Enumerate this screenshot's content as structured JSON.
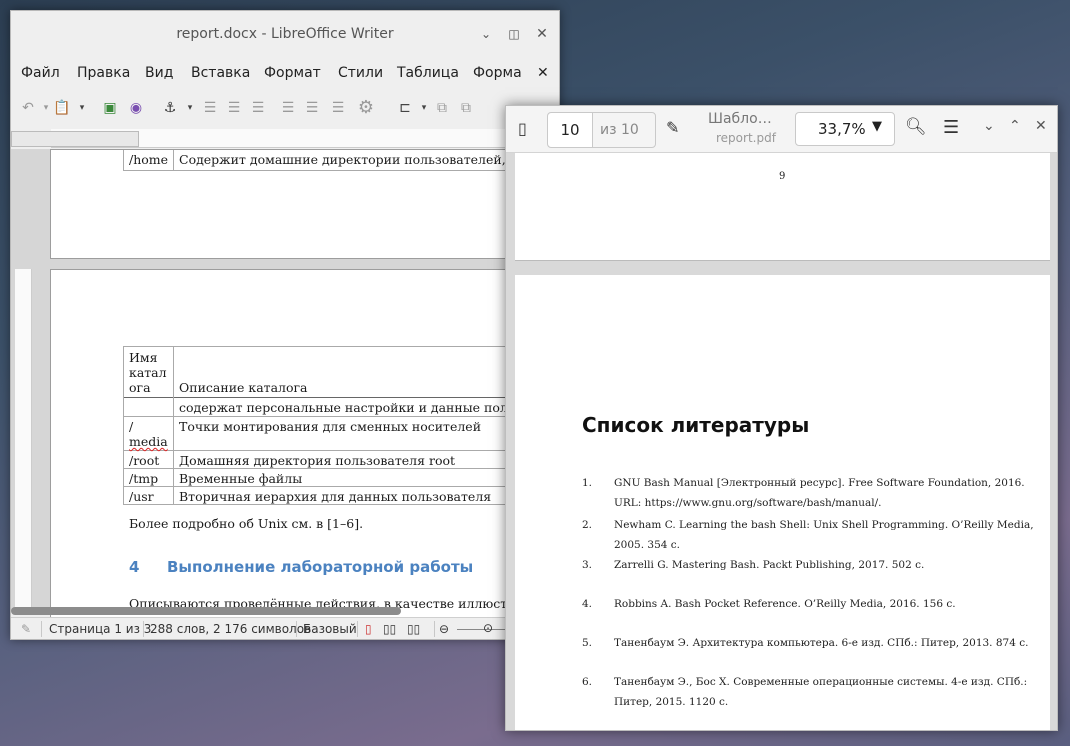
{
  "writer": {
    "title": "report.docx - LibreOffice Writer",
    "menu": [
      "Файл",
      "Правка",
      "Вид",
      "Вставка",
      "Формат",
      "Стили",
      "Таблица",
      "Форма"
    ],
    "page1_row": {
      "dir": "/home",
      "desc": "Содержит домашние директории пользователей, котор"
    },
    "table": {
      "header": {
        "name": [
          "Имя",
          "катал",
          "ога"
        ],
        "desc": "Описание каталога"
      },
      "rows": [
        {
          "dir": "",
          "desc": "содержат персональные настройки и данные пользоват"
        },
        {
          "dir": [
            "/",
            "media"
          ],
          "desc": "Точки монтирования для сменных носителей"
        },
        {
          "dir": "/root",
          "desc": "Домашняя директория пользователя root"
        },
        {
          "dir": "/tmp",
          "desc": "Временные файлы"
        },
        {
          "dir": "/usr",
          "desc": "Вторичная иерархия для данных пользователя"
        }
      ]
    },
    "after_table": "Более подробно об Unix см. в [1–6].",
    "section_num": "4",
    "section_title": "Выполнение лабораторной работы",
    "body_text": "Описываются проведённые действия, в качестве иллюстрации д",
    "status": {
      "page": "Страница 1 из 3",
      "words": "288 слов, 2 176 символов",
      "style": "Базовый"
    }
  },
  "pdf": {
    "page_current": "10",
    "page_total": "из 10",
    "doc_title": "Шабло…",
    "doc_file": "report.pdf",
    "zoom": "33,7%",
    "prev_page_number": "9",
    "heading": "Список литературы",
    "refs": [
      {
        "n": "1.",
        "lines": [
          "GNU Bash Manual [Электронный ресурс]. Free Software Foundation, 2016.",
          "URL: https://www.gnu.org/software/bash/manual/."
        ]
      },
      {
        "n": "2.",
        "lines": [
          "Newham C. Learning the bash Shell: Unix Shell Programming. O’Reilly Media,",
          "2005. 354 с."
        ]
      },
      {
        "n": "3.",
        "lines": [
          "Zarrelli G. Mastering Bash. Packt Publishing, 2017. 502 с."
        ]
      },
      {
        "n": "4.",
        "lines": [
          "Robbins A. Bash Pocket Reference. O’Reilly Media, 2016. 156 с."
        ]
      },
      {
        "n": "5.",
        "lines": [
          "Таненбаум Э. Архитектура компьютера. 6-е изд. СПб.: Питер, 2013. 874 с."
        ]
      },
      {
        "n": "6.",
        "lines": [
          "Таненбаум Э., Бос Х. Современные операционные системы. 4-е изд. СПб.:",
          "Питер, 2015. 1120 с."
        ]
      }
    ]
  }
}
